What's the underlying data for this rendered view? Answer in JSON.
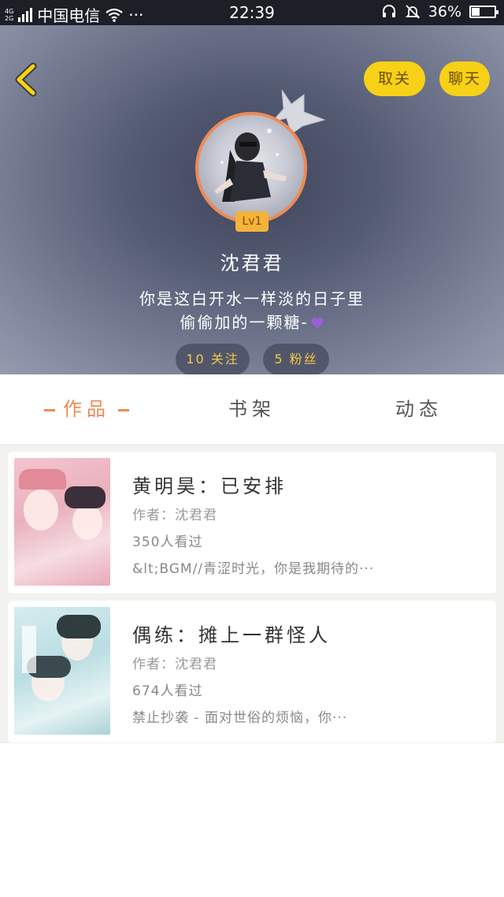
{
  "status_bar": {
    "network_top": "4G",
    "network_bottom": "2G",
    "carrier": "中国电信",
    "more": "···",
    "time": "22:39",
    "battery": "36%",
    "battery_level": 0.36
  },
  "header": {
    "unfollow_label": "取关",
    "chat_label": "聊天",
    "level": "Lv1",
    "username": "沈君君",
    "bio_line1": "你是这白开水一样淡的日子里",
    "bio_line2": "偷偷加的一颗糖-",
    "following": "10 关注",
    "fans": "5 粉丝"
  },
  "tabs": {
    "works": "作品",
    "shelf": "书架",
    "moments": "动态"
  },
  "works": [
    {
      "title": "黄明昊：已安排",
      "author": "作者：沈君君",
      "views": "350人看过",
      "desc": "&lt;BGM//青涩时光，你是我期待的···"
    },
    {
      "title": "偶练：摊上一群怪人",
      "author": "作者：沈君君",
      "views": "674人看过",
      "desc": "禁止抄袭 - 面对世俗的烦恼，你···"
    }
  ],
  "colors": {
    "accent": "#ee8a55",
    "button_yellow": "#f7d117",
    "stat_text": "#f2c84b"
  },
  "icons": [
    "back-chevron-icon",
    "crown-icon",
    "purple-heart-icon",
    "wifi-icon",
    "headset-icon",
    "mute-bell-icon",
    "battery-icon"
  ]
}
